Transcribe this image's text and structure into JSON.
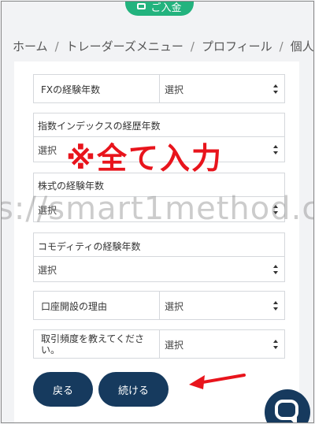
{
  "header": {
    "deposit_button_label": "ご入金"
  },
  "breadcrumb": [
    {
      "label": "ホーム"
    },
    {
      "label": "トレーダーズメニュー"
    },
    {
      "label": "プロフィール"
    },
    {
      "label": "個人情"
    }
  ],
  "form": {
    "fields": [
      {
        "label": "FXの経験年数",
        "value": "選択"
      },
      {
        "label": "指数インデックスの経歴年数",
        "value": "選択"
      },
      {
        "label": "株式の経験年数",
        "value": "選択"
      },
      {
        "label": "コモディティの経験年数",
        "value": "選択"
      },
      {
        "label": "口座開設の理由",
        "value": "選択"
      },
      {
        "label": "取引頻度を教えてください。",
        "value": "選択"
      }
    ],
    "back_label": "戻る",
    "continue_label": "続ける"
  },
  "annotation": {
    "text": "※全て入力",
    "color": "#e8141c"
  },
  "watermark": {
    "text": "s://smart1method.c"
  },
  "colors": {
    "accent": "#23b37e",
    "button": "#163a5e"
  }
}
